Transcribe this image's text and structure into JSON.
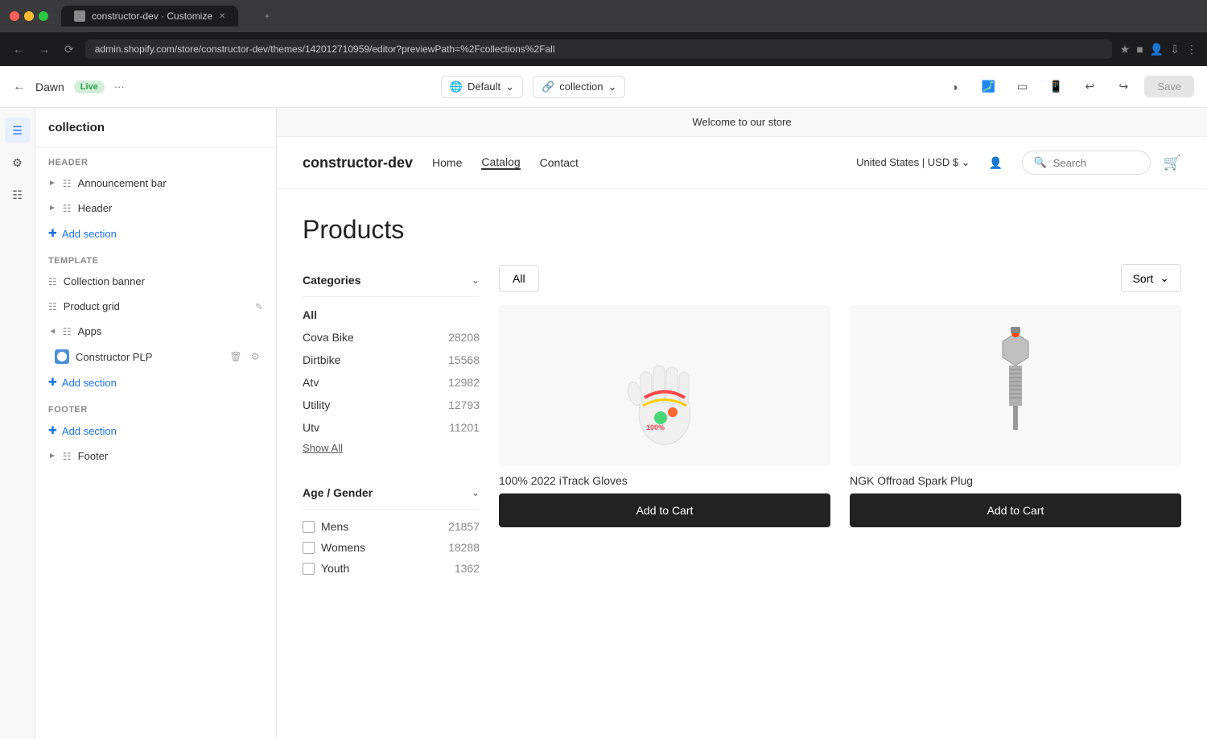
{
  "browser": {
    "url": "admin.shopify.com/store/constructor-dev/themes/142012710959/editor?previewPath=%2Fcollections%2Fall",
    "tab_title": "constructor-dev · Customize"
  },
  "app_header": {
    "theme_name": "Dawn",
    "live_label": "Live",
    "more_label": "···",
    "default_label": "Default",
    "context_label": "collection",
    "save_label": "Save"
  },
  "sidebar": {
    "title": "collection",
    "header_label": "Header",
    "announcement_bar_label": "Announcement bar",
    "header_item_label": "Header",
    "add_section_label": "Add section",
    "template_label": "Template",
    "collection_banner_label": "Collection banner",
    "product_grid_label": "Product grid",
    "apps_label": "Apps",
    "constructor_plp_label": "Constructor PLP",
    "footer_label": "Footer",
    "footer_item_label": "Footer",
    "add_section_footer_label": "Add section"
  },
  "store": {
    "announcement": "Welcome to our store",
    "logo": "constructor-dev",
    "nav_links": [
      "Home",
      "Catalog",
      "Contact"
    ],
    "active_nav": "Catalog",
    "locale": "United States | USD $",
    "search_placeholder": "Search",
    "products_title": "Products",
    "filter_categories_title": "Categories",
    "filter_age_title": "Age / Gender",
    "categories": [
      {
        "name": "All",
        "count": null,
        "selected": true
      },
      {
        "name": "Cova Bike",
        "count": "28208"
      },
      {
        "name": "Dirtbike",
        "count": "15568"
      },
      {
        "name": "Atv",
        "count": "12982"
      },
      {
        "name": "Utility",
        "count": "12793"
      },
      {
        "name": "Utv",
        "count": "11201"
      }
    ],
    "show_all_label": "Show All",
    "age_filters": [
      {
        "name": "Mens",
        "count": "21857"
      },
      {
        "name": "Womens",
        "count": "18288"
      },
      {
        "name": "Youth",
        "count": "1362"
      }
    ],
    "all_filter_label": "All",
    "sort_label": "Sort",
    "products": [
      {
        "name": "100% 2022 iTrack Gloves",
        "add_to_cart_label": "Add to Cart",
        "has_image": "glove"
      },
      {
        "name": "NGK Offroad Spark Plug",
        "add_to_cart_label": "Add to Cart",
        "has_image": "spark-plug"
      }
    ]
  }
}
